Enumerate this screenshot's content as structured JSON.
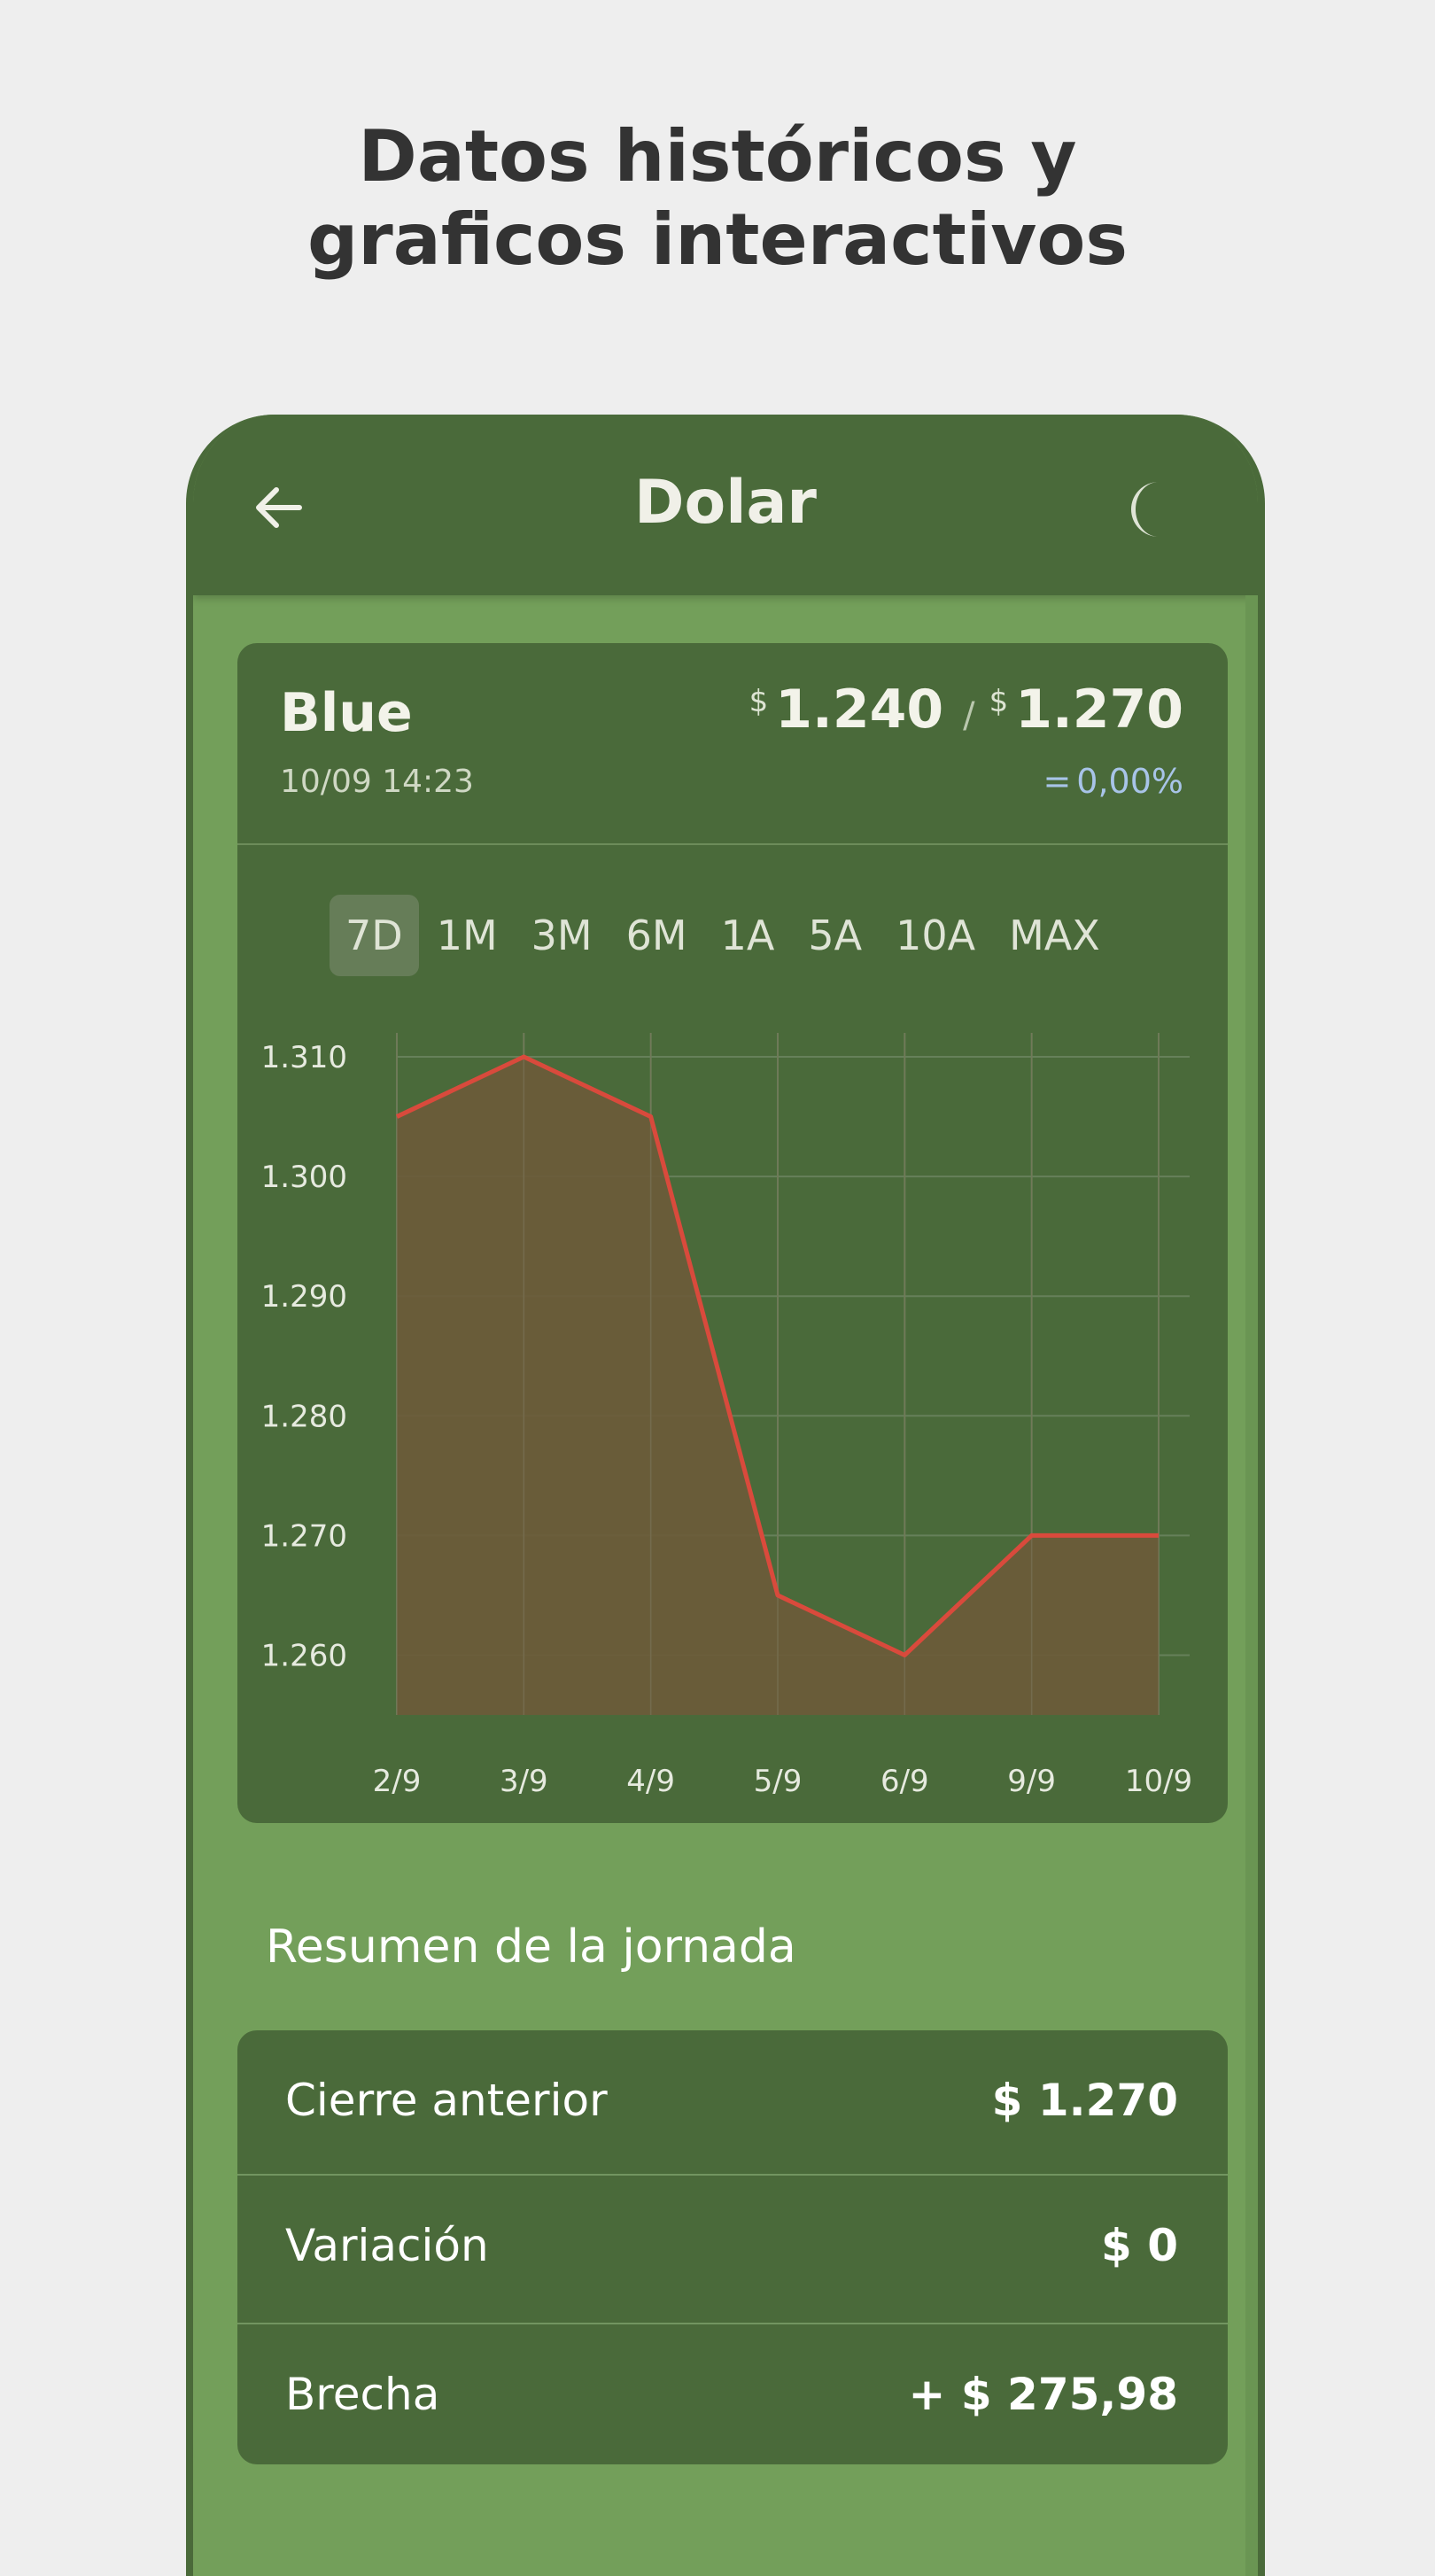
{
  "promo": {
    "title_line1": "Datos históricos y",
    "title_line2": "graficos interactivos"
  },
  "appbar": {
    "title": "Dolar",
    "back_icon": "arrow-left-icon",
    "theme_icon": "moon-icon"
  },
  "quote": {
    "name": "Blue",
    "timestamp": "10/09 14:23",
    "currency_symbol": "$",
    "buy": "1.240",
    "separator": "/",
    "sell": "1.270",
    "change_symbol": "=",
    "change": "0,00%"
  },
  "ranges": [
    {
      "label": "7D",
      "active": true
    },
    {
      "label": "1M",
      "active": false
    },
    {
      "label": "3M",
      "active": false
    },
    {
      "label": "6M",
      "active": false
    },
    {
      "label": "1A",
      "active": false
    },
    {
      "label": "5A",
      "active": false
    },
    {
      "label": "10A",
      "active": false
    },
    {
      "label": "MAX",
      "active": false
    }
  ],
  "chart_data": {
    "type": "area",
    "categories": [
      "2/9",
      "3/9",
      "4/9",
      "5/9",
      "6/9",
      "9/9",
      "10/9"
    ],
    "values": [
      1305,
      1310,
      1305,
      1265,
      1260,
      1270,
      1270
    ],
    "yticks": [
      1260,
      1270,
      1280,
      1290,
      1300,
      1310
    ],
    "ytick_labels": [
      "1.260",
      "1.270",
      "1.280",
      "1.290",
      "1.300",
      "1.310"
    ],
    "ylim": [
      1255,
      1312
    ],
    "grid": true,
    "line_color": "#d94a3c",
    "fill_color": "#6b5b3a"
  },
  "summary": {
    "title": "Resumen de la jornada",
    "rows": [
      {
        "label": "Cierre anterior",
        "value": "$ 1.270"
      },
      {
        "label": "Variación",
        "value": "$ 0"
      },
      {
        "label": "Brecha",
        "value": "+ $ 275,98"
      }
    ]
  },
  "colors": {
    "appbar": "#4a6a3a",
    "background": "#739f5a",
    "card": "#4a6a3a",
    "change_neutral": "#a8c4e8"
  }
}
